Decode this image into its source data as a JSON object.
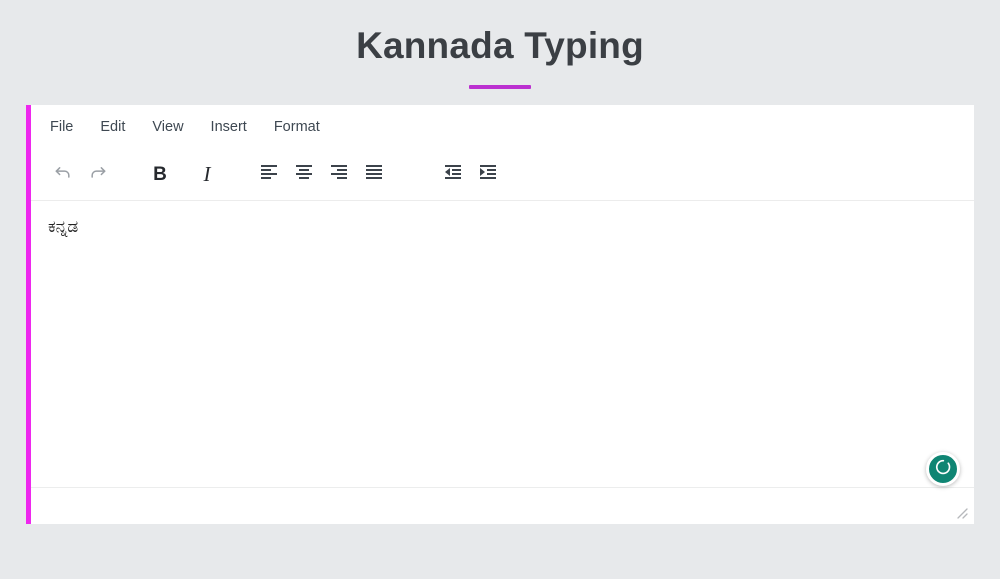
{
  "page": {
    "title": "Kannada Typing",
    "background_color": "#e7e9eb",
    "accent_color": "#bb30d0",
    "editor_border_color": "#ee27ee"
  },
  "editor": {
    "menubar": [
      {
        "label": "File",
        "name": "menu-file"
      },
      {
        "label": "Edit",
        "name": "menu-edit"
      },
      {
        "label": "View",
        "name": "menu-view"
      },
      {
        "label": "Insert",
        "name": "menu-insert"
      },
      {
        "label": "Format",
        "name": "menu-format"
      }
    ],
    "toolbar": [
      {
        "icon": "undo-icon",
        "label": "Undo"
      },
      {
        "icon": "redo-icon",
        "label": "Redo"
      },
      {
        "icon": "bold-icon",
        "label": "B"
      },
      {
        "icon": "italic-icon",
        "label": "I"
      },
      {
        "icon": "align-left-icon",
        "label": "Align left"
      },
      {
        "icon": "align-center-icon",
        "label": "Align center"
      },
      {
        "icon": "align-right-icon",
        "label": "Align right"
      },
      {
        "icon": "align-justify-icon",
        "label": "Justify"
      },
      {
        "icon": "decrease-indent-icon",
        "label": "Decrease indent"
      },
      {
        "icon": "increase-indent-icon",
        "label": "Increase indent"
      }
    ],
    "document": {
      "content": "ಕನ್ನಡ"
    },
    "fab": {
      "icon": "loading-spinner-icon",
      "color": "#0f8573"
    },
    "resize_handle": {
      "icon": "resize-grip-icon"
    }
  }
}
